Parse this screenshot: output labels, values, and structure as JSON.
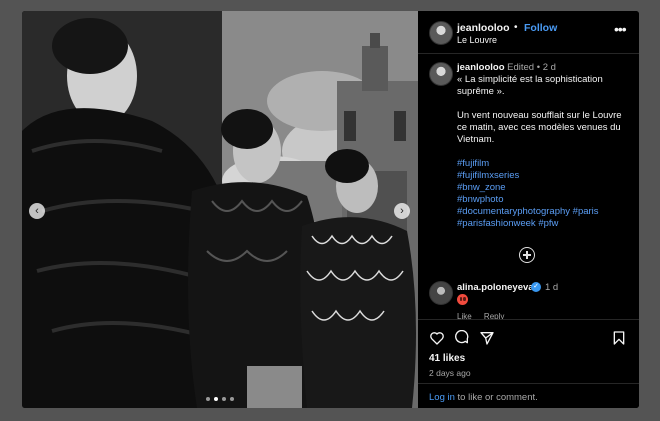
{
  "post": {
    "username": "jeanlooloo",
    "follow_label": "Follow",
    "location": "Le Louvre",
    "separator": "•",
    "more_label": "•••"
  },
  "caption": {
    "username": "jeanlooloo",
    "edited": "Edited",
    "age": "2 d",
    "line1": "« La simplicité est la sophistication suprême ».",
    "line2": "Un vent nouveau soufflait sur le Louvre ce matin, avec ces modèles venues du Vietnam.",
    "hashtags": [
      "#fujifilm",
      "#fujifilmxseries",
      "#bnw_zone",
      "#bnwphoto",
      "#documentaryphotography",
      "#paris",
      "#parisfashionweek",
      "#pfw"
    ]
  },
  "comment": {
    "username": "alina.poloneyeva",
    "age": "1 d",
    "emoji": "smiling-face-with-heart-eyes",
    "like_label": "Like",
    "reply_label": "Reply"
  },
  "actions": {
    "likes": "41 likes",
    "posted": "2 days ago",
    "login_link": "Log in",
    "login_rest": " to like or comment."
  },
  "carousel": {
    "slide_count": 4,
    "active_index": 1
  },
  "colors": {
    "link": "#4a9bf5",
    "hashtag": "#5b9ef5",
    "verified": "#3897f0"
  }
}
